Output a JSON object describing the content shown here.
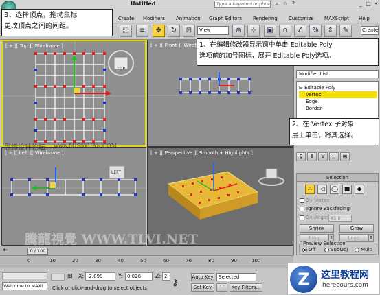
{
  "window": {
    "title": "Untitled",
    "search_placeholder": "Type a keyword or phrase"
  },
  "menu": [
    "Create",
    "Modifiers",
    "Animation",
    "Graph Editors",
    "Rendering",
    "Customize",
    "MAXScript",
    "Help"
  ],
  "toolbar": {
    "view_select": "View",
    "create_select": "Create"
  },
  "viewports": {
    "top": "[ + ][ Top ][ Wireframe ]",
    "front": "[ + ][ Front ][ Wireframe ]",
    "left": "[ + ][ Left ][ Wireframe ]",
    "perspective": "[ + ][ Perspective ][ Smooth + Highlights ]",
    "viewcube_top": "TOP",
    "viewcube_left": "LEFT"
  },
  "command_panel": {
    "modifier_list": "Modifier List",
    "stack": [
      "Editable Poly",
      "Vertex",
      "Edge",
      "Border"
    ],
    "selection_title": "Selection",
    "by_vertex": "By Vertex",
    "ignore_backfacing": "Ignore Backfacing",
    "by_angle": "By Angle:",
    "angle_value": "45.0",
    "shrink": "Shrink",
    "grow": "Grow",
    "ring": "Ring",
    "loop": "Loop",
    "preview_selection": "Preview Selection",
    "preview_options": [
      "Off",
      "SubObj",
      "Multi"
    ]
  },
  "timeline": {
    "frame": "0 / 100",
    "ticks": [
      "0",
      "10",
      "20",
      "30",
      "40",
      "50",
      "60",
      "70",
      "80",
      "90",
      "100"
    ]
  },
  "status_bar": {
    "maxscript": "Welcome to MAX!",
    "x_label": "X:",
    "x_value": "-2.899",
    "y_label": "Y:",
    "y_value": "0.026",
    "z_label": "Z:",
    "z_value": "2.",
    "prompt": "Click or click-and-drag to select objects",
    "auto_key": "Auto Key",
    "set_key": "Set Key",
    "selected": "Selected",
    "key_filters": "Key Filters..."
  },
  "callouts": {
    "step3_line1": "3、选择顶点，拖动鼠标",
    "step3_line2": "更改顶点之间的间距。",
    "step1_line1": "1、在编辑修改器显示窗中单击 Editable Poly",
    "step1_line2": "选项前的加号图标，展开 Editable Poly选项。",
    "step2_line1": "2、在 Vertex 子对象",
    "step2_line2": "层上单击，将其选择。"
  },
  "watermarks": {
    "forum": "思缘设计论坛",
    "forum_url": "www.MISSYUAN.COM",
    "tlvi": "騰龍視覺 WWW.TLVI.NET"
  },
  "badge": {
    "logo_letter": "Z",
    "title": "这里教程网",
    "url": "herecours.com"
  },
  "colors": {
    "selection_yellow": "#f5d23a",
    "vertex_red": "#e02020",
    "edge_white": "#ffffff",
    "object_orange": "#e8b838"
  }
}
